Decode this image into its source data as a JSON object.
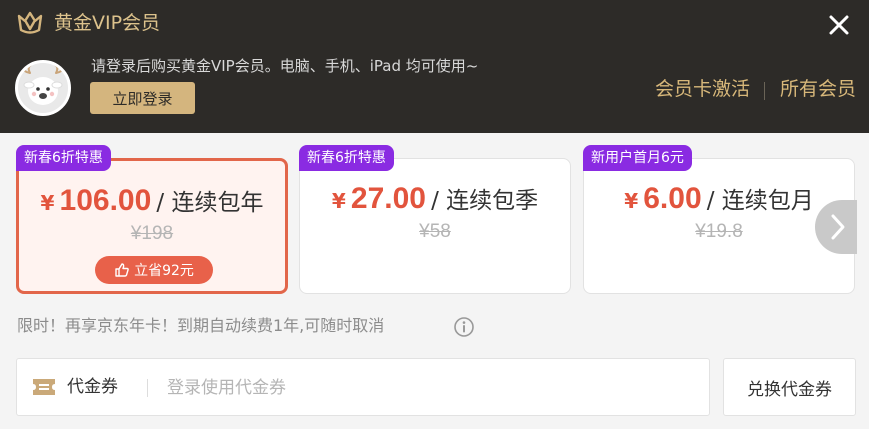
{
  "header": {
    "title": "黄金VIP会员",
    "notice": "请登录后购买黄金VIP会员。电脑、手机、iPad 均可使用~",
    "login_button": "立即登录",
    "activate_link": "会员卡激活",
    "all_members_link": "所有会员",
    "icons": {
      "brand": "crown-v-icon",
      "close": "close-icon",
      "avatar": "deer-avatar"
    }
  },
  "plans": [
    {
      "badge": "新春6折特惠",
      "currency": "¥",
      "price": "106.00",
      "unit": "/ 连续包年",
      "original_price": "¥198",
      "save_label": "立省92元",
      "selected": true
    },
    {
      "badge": "新春6折特惠",
      "currency": "¥",
      "price": "27.00",
      "unit": "/ 连续包季",
      "original_price": "¥58",
      "selected": false
    },
    {
      "badge": "新用户首月6元",
      "currency": "¥",
      "price": "6.00",
      "unit": "/ 连续包月",
      "original_price": "¥19.8",
      "selected": false
    }
  ],
  "promo_text": "限时！再享京东年卡！到期自动续费1年,可随时取消",
  "coupon": {
    "label": "代金券",
    "placeholder": "登录使用代金券",
    "redeem_button": "兑换代金券"
  },
  "colors": {
    "header_bg": "#2d2b28",
    "gold": "#d4b57e",
    "price_red": "#e2543d",
    "badge_purple": "#8a2be2",
    "selected_border": "#e2664a"
  }
}
